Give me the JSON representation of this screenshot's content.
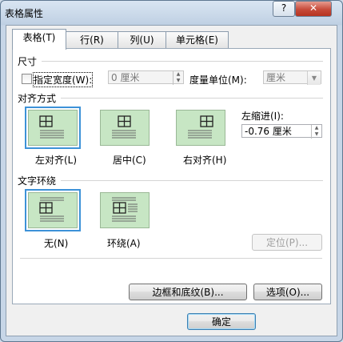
{
  "window": {
    "title": "表格属性",
    "help_label": "?",
    "close_label": "✕"
  },
  "tabs": [
    {
      "label": "表格(T)"
    },
    {
      "label": "行(R)"
    },
    {
      "label": "列(U)"
    },
    {
      "label": "单元格(E)"
    }
  ],
  "size": {
    "section": "尺寸",
    "specify_width_label": "指定宽度(W):",
    "specify_width_checked": false,
    "width_value": "0 厘米",
    "measure_label": "度量单位(M):",
    "measure_value": "厘米"
  },
  "alignment": {
    "section": "对齐方式",
    "options": [
      {
        "label": "左对齐(L)",
        "selected": true
      },
      {
        "label": "居中(C)",
        "selected": false
      },
      {
        "label": "右对齐(H)",
        "selected": false
      }
    ],
    "indent_label": "左缩进(I):",
    "indent_value": "-0.76 厘米"
  },
  "wrapping": {
    "section": "文字环绕",
    "options": [
      {
        "label": "无(N)",
        "selected": true
      },
      {
        "label": "环绕(A)",
        "selected": false
      }
    ],
    "position_label": "定位(P)..."
  },
  "buttons": {
    "borders_label": "边框和底纹(B)...",
    "options_label": "选项(O)...",
    "ok_label": "确定"
  },
  "colors": {
    "tile": "#c7e6c4",
    "selection": "#3d92d8"
  }
}
